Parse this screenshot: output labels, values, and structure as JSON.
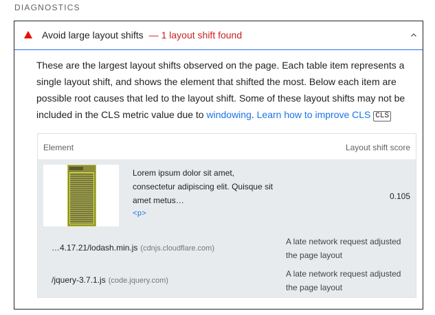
{
  "section": {
    "title": "DIAGNOSTICS"
  },
  "audit": {
    "title": "Avoid large layout shifts",
    "separator": "—",
    "display_value": "1 layout shift found",
    "status_color": "#eb0f00",
    "accent_color": "#1a73e8",
    "expanded": true,
    "description": {
      "text": "These are the largest layout shifts observed on the page. Each table item represents a single layout shift, and shows the element that shifted the most. Below each item are possible root causes that led to the layout shift. Some of these layout shifts may not be included in the CLS metric value due to ",
      "link1": "windowing",
      "after_link1": ". ",
      "link2": "Learn how to improve CLS",
      "badge": "CLS"
    }
  },
  "table": {
    "headers": {
      "element": "Element",
      "score": "Layout shift score"
    },
    "items": [
      {
        "snippet": "Lorem ipsum dolor sit amet, consectetur adipiscing elit. Quisque sit amet metus…",
        "node": "<p>",
        "score": "0.105",
        "causes": [
          {
            "url": "…4.17.21/lodash.min.js",
            "origin": "(cdnjs.cloudflare.com)",
            "reason": "A late network request adjusted the page layout"
          },
          {
            "url": "/jquery-3.7.1.js",
            "origin": "(code.jquery.com)",
            "reason": "A late network request adjusted the page layout"
          }
        ]
      }
    ]
  }
}
